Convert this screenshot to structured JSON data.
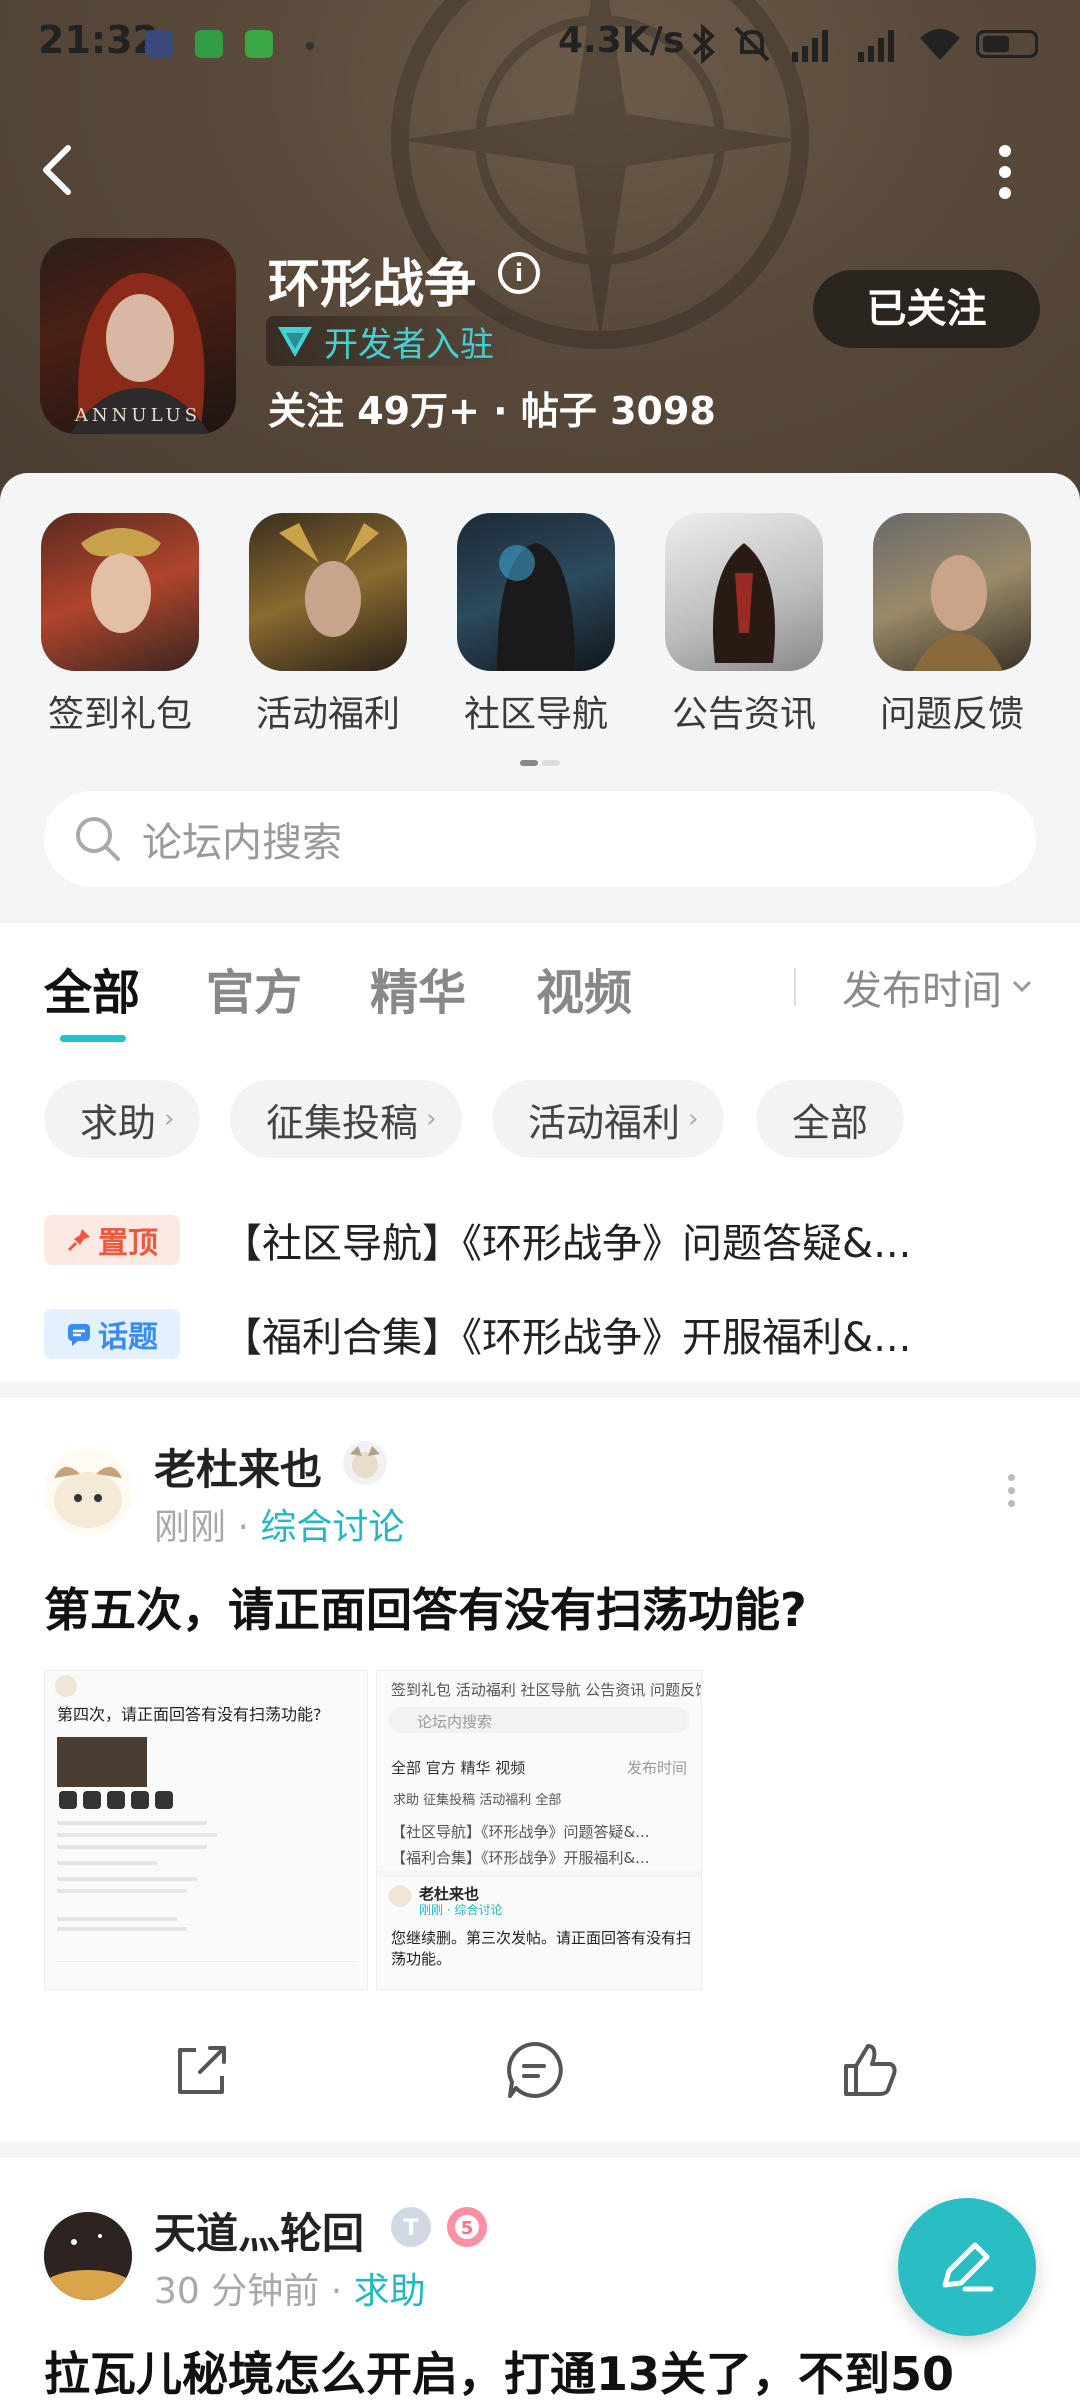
{
  "status_bar": {
    "time": "21:32",
    "net_speed": "4.3K/s"
  },
  "forum": {
    "title": "环形战争",
    "dev_badge": "开发者入驻",
    "stats": "关注 49万+ · 帖子 3098",
    "follow_label": "已关注",
    "icon_caption": "ANNULUS"
  },
  "quick_entries": [
    {
      "label": "签到礼包"
    },
    {
      "label": "活动福利"
    },
    {
      "label": "社区导航"
    },
    {
      "label": "公告资讯"
    },
    {
      "label": "问题反馈"
    }
  ],
  "search": {
    "placeholder": "论坛内搜索"
  },
  "tabs": [
    "全部",
    "官方",
    "精华",
    "视频"
  ],
  "sort_label": "发布时间",
  "filter_chips": [
    "求助",
    "征集投稿",
    "活动福利",
    "全部"
  ],
  "pinned": [
    {
      "badge": "置顶",
      "text": "【社区导航】《环形战争》问题答疑&..."
    },
    {
      "badge": "话题",
      "text": "【福利合集】《环形战争》开服福利&..."
    }
  ],
  "posts": [
    {
      "author": "老杜来也",
      "time": "刚刚",
      "category": "综合讨论",
      "title": "第五次，请正面回答有没有扫荡功能?",
      "thumb1": {
        "line1": "第四次，请正面回答有没有扫荡功能?"
      },
      "thumb2": {
        "entries": "签到礼包  活动福利  社区导航  公告资讯  问题反馈",
        "search": "论坛内搜索",
        "tabs": "全部   官方   精华   视频",
        "sort": "发布时间",
        "chips": "求助     征集投稿     活动福利     全部",
        "pin1": "【社区导航】《环形战争》问题答疑&...",
        "pin2": "【福利合集】《环形战争》开服福利&...",
        "author": "老杜来也",
        "meta": "刚刚 · 综合讨论",
        "body": "您继续删。第三次发帖。请正面回答有没有扫荡功能。"
      }
    },
    {
      "author": "天道灬轮回",
      "time": "30 分钟前",
      "category": "求助",
      "title": "拉瓦儿秘境怎么开启，打通13关了，不到50"
    }
  ],
  "colors": {
    "accent": "#24c2c6",
    "header_bg": "#5a4a3b",
    "pin_top": "#fde9e4",
    "pin_topic": "#e3f0fe"
  }
}
